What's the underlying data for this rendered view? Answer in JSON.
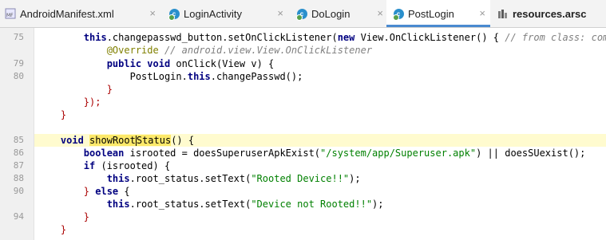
{
  "tabs": [
    {
      "label": "AndroidManifest.xml",
      "icon": "manifest-file-icon",
      "active": false
    },
    {
      "label": "LoginActivity",
      "icon": "class-icon",
      "active": false
    },
    {
      "label": "DoLogin",
      "icon": "class-icon",
      "active": false
    },
    {
      "label": "PostLogin",
      "icon": "class-icon",
      "active": true
    },
    {
      "label": "resources.arsc",
      "icon": "resources-file-icon",
      "active": false
    }
  ],
  "tab_close_glyph": "×",
  "line_numbers": [
    "75",
    "",
    "79",
    "80",
    "",
    "",
    "",
    "",
    "85",
    "86",
    "87",
    "88",
    "90",
    "",
    "94",
    "",
    ""
  ],
  "code": {
    "l1": {
      "indent": "        ",
      "a": "this",
      "b": ".changepasswd_button.setOnClickListener(",
      "c": "new",
      "d": " View.OnClickListener() { ",
      "e": "// from class: com.ar"
    },
    "l2": {
      "indent": "            ",
      "a": "@Override",
      "b": " // android.view.View.OnClickListener"
    },
    "l3": {
      "indent": "            ",
      "a": "public",
      "b": " ",
      "c": "void",
      "d": " onClick(View v) {"
    },
    "l4": {
      "indent": "                ",
      "a": "PostLogin.",
      "b": "this",
      ".c": "",
      "c": ".changePasswd();"
    },
    "l5": {
      "indent": "            ",
      "a": "}"
    },
    "l6": {
      "indent": "        ",
      "a": "});"
    },
    "l7": {
      "indent": "    ",
      "a": "}"
    },
    "l9": {
      "indent": "    ",
      "a": "void",
      "b": " ",
      "c": "showRoot",
      "d": "Status",
      "e": "() {"
    },
    "l10": {
      "indent": "        ",
      "a": "boolean",
      "b": " isrooted = doesSuperuserApkExist(",
      "c": "\"/system/app/Superuser.apk\"",
      "d": ") || doesSUexist();"
    },
    "l11": {
      "indent": "        ",
      "a": "if",
      "b": " (isrooted) {"
    },
    "l12": {
      "indent": "            ",
      "a": "this",
      "b": ".root_status.setText(",
      "c": "\"Rooted Device!!\"",
      "d": ");"
    },
    "l13": {
      "indent": "        ",
      "a": "} ",
      "b": "else",
      "c": " {"
    },
    "l14": {
      "indent": "            ",
      "a": "this",
      "b": ".root_status.setText(",
      "c": "\"Device not Rooted!!\"",
      "d": ");"
    },
    "l15": {
      "indent": "        ",
      "a": "}"
    },
    "l16": {
      "indent": "    ",
      "a": "}"
    }
  }
}
